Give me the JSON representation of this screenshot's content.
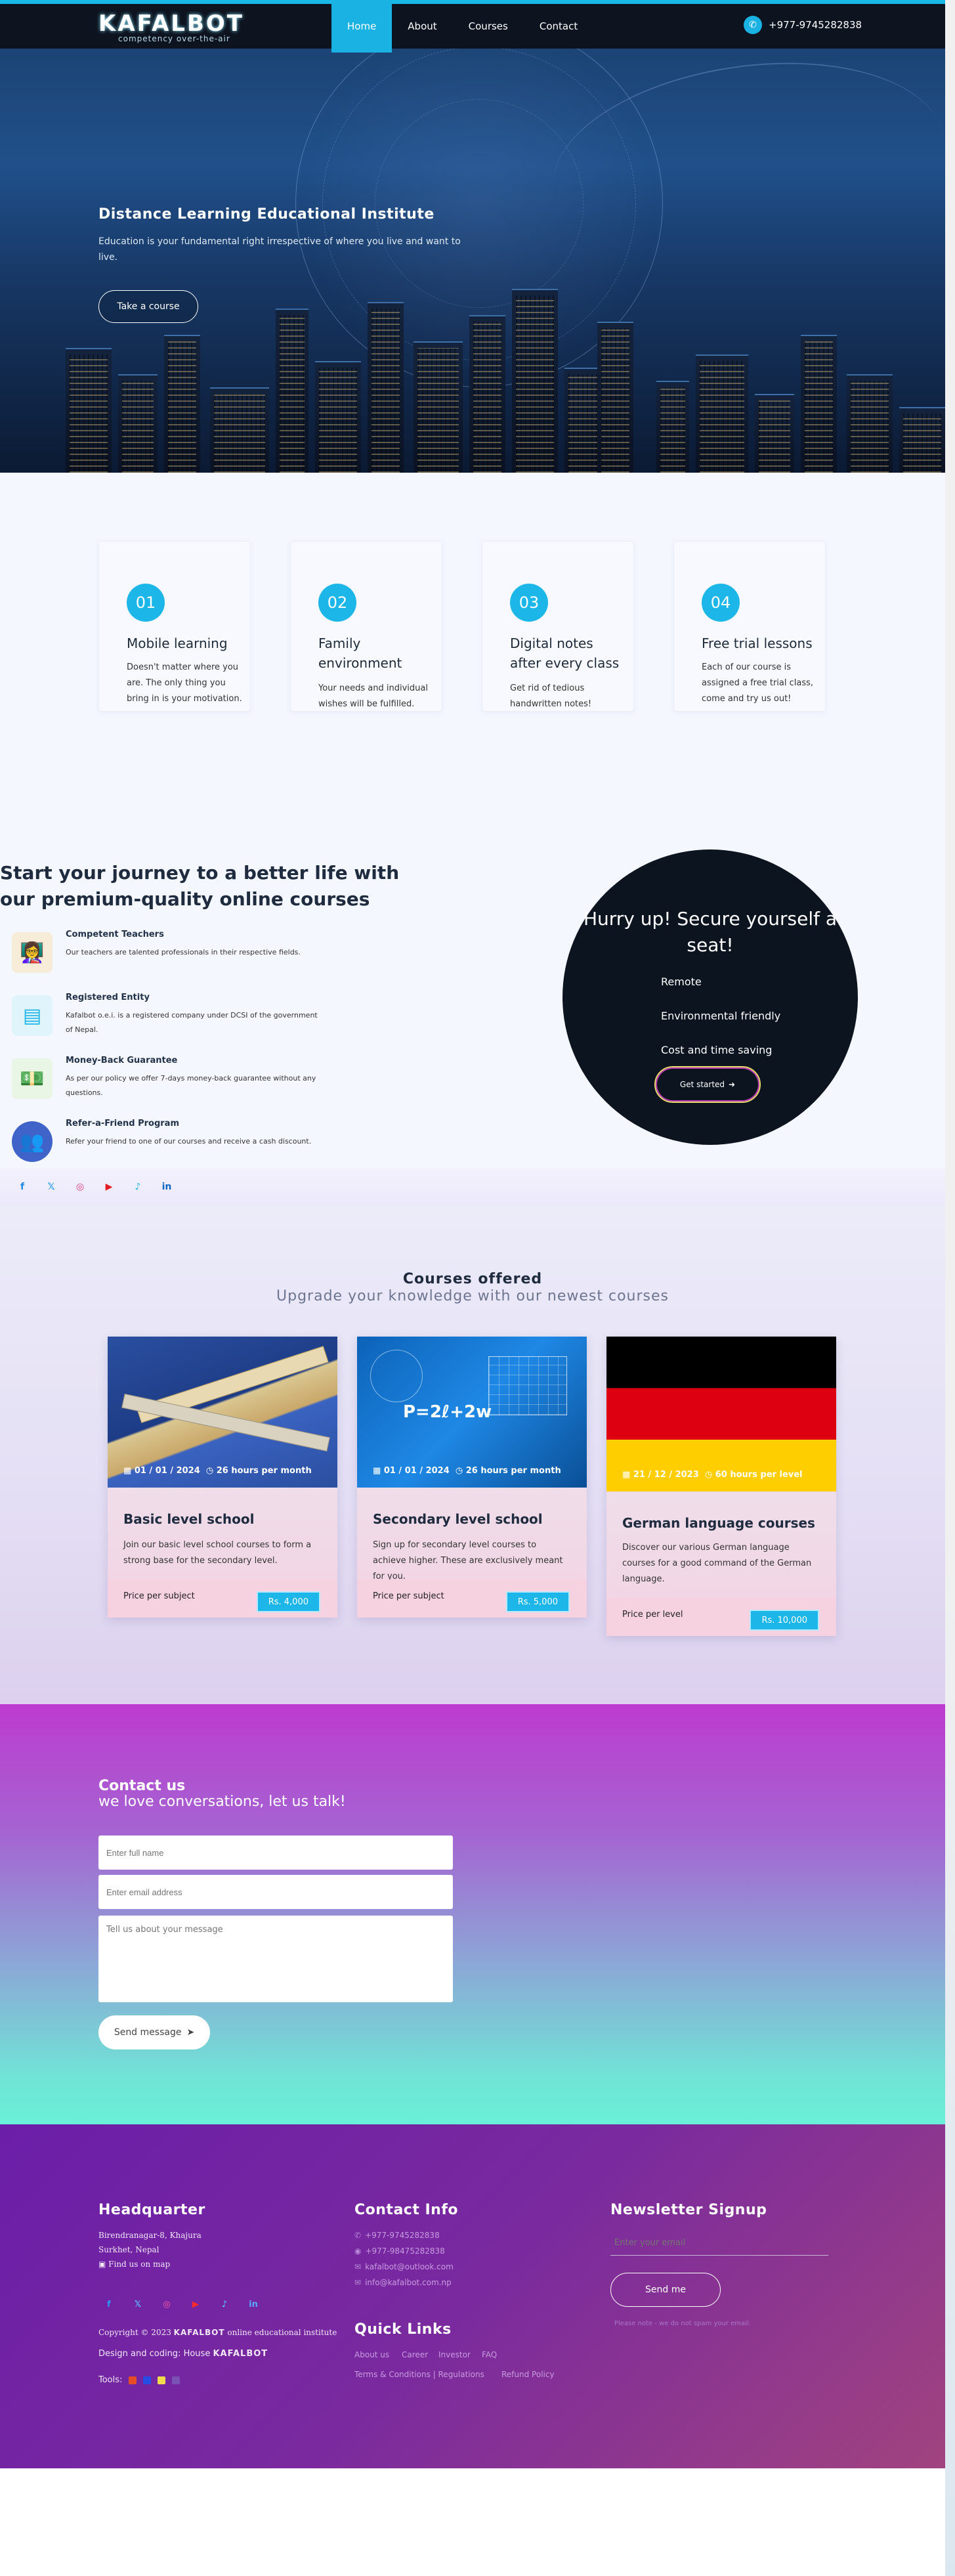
{
  "nav": {
    "brand": "KAFALBOT",
    "tagline": "competency over-the-air",
    "links": [
      "Home",
      "About",
      "Courses",
      "Contact"
    ],
    "phone": "+977-9745282838",
    "accent": "#19b2e3"
  },
  "hero": {
    "title": "Distance Learning Educational Institute",
    "subtitle": "Education is your fundamental right irrespective of where you live and want to live.",
    "button": "Take a course"
  },
  "features": [
    {
      "num": "01",
      "title": "Mobile learning",
      "desc": "Doesn't matter where you are. The only thing you bring in is your motivation."
    },
    {
      "num": "02",
      "title": "Family environment",
      "desc": "Your needs and individual wishes will be fulfilled."
    },
    {
      "num": "03",
      "title": "Digital notes after every class",
      "desc": "Get rid of tedious handwritten notes!"
    },
    {
      "num": "04",
      "title": "Free trial lessons",
      "desc": "Each of our course is assigned a free trial class, come and try us out!"
    }
  ],
  "journey": {
    "title": "Start your journey to a better life with our premium-quality online courses",
    "items": [
      {
        "title": "Competent Teachers",
        "desc": "Our teachers are talented professionals in their respective fields."
      },
      {
        "title": "Registered Entity",
        "desc": "Kafalbot o.e.i. is a registered company under DCSI of the government of Nepal."
      },
      {
        "title": "Money-Back Guarantee",
        "desc": "As per our policy we offer 7-days money-back guarantee without any questions."
      },
      {
        "title": "Refer-a-Friend Program",
        "desc": "Refer your friend to one of our courses and receive a cash discount."
      }
    ],
    "seat": {
      "title": "Hurry up! Secure yourself a seat!",
      "items": [
        "Remote",
        "Environmental friendly",
        "Cost and time saving"
      ],
      "button": "Get started"
    }
  },
  "courses": {
    "title": "Courses offered",
    "subtitle": "Upgrade your knowledge with our newest courses",
    "items": [
      {
        "date": "01 / 01 / 2024",
        "hours": "26 hours per month",
        "name": "Basic level school",
        "desc": "Join our basic level school courses to form a strong base for the secondary level.",
        "price_label": "Price per subject",
        "price": "Rs. 4,000"
      },
      {
        "date": "01 / 01 / 2024",
        "hours": "26 hours per month",
        "name": "Secondary level school",
        "desc": "Sign up for secondary level courses to achieve higher. These are exclusively meant for you.",
        "price_label": "Price per subject",
        "price": "Rs. 5,000"
      },
      {
        "date": "21 / 12 / 2023",
        "hours": "60 hours per level",
        "name": "German language courses",
        "desc": "Discover our various German language courses for a good command of the German language.",
        "price_label": "Price per level",
        "price": "Rs. 10,000"
      }
    ]
  },
  "contact": {
    "title": "Contact us",
    "subtitle": "we love conversations, let us talk!",
    "name_placeholder": "Enter full name",
    "email_placeholder": "Enter email address",
    "message_placeholder": "Tell us about your message",
    "send": "Send message"
  },
  "footer": {
    "hq_title": "Headquarter",
    "address": [
      "Birendranagar-8, Khajura",
      "Surkhet, Nepal"
    ],
    "map_link": "Find us on map",
    "copyright": "Copyright © 2023",
    "copyright_brand": "KAFALBOT",
    "copyright_tail": "online educational institute",
    "design_text": "Design and coding: House",
    "design_brand": "KAFALBOT",
    "tools_label": "Tools:",
    "contact_title": "Contact Info",
    "contacts": [
      "+977-9745282838",
      "+977-98475282838",
      "kafalbot@outlook.com",
      "info@kafalbot.com.np"
    ],
    "links_title": "Quick Links",
    "links_row1": [
      "About us",
      "Career",
      "Investor",
      "FAQ"
    ],
    "links_row2": [
      "Terms & Conditions | Regulations",
      "Refund Policy"
    ],
    "newsletter_title": "Newsletter Signup",
    "newsletter_placeholder": "Enter your email",
    "newsletter_button": "Send me",
    "newsletter_note": "Please note - we do not spam your email."
  }
}
